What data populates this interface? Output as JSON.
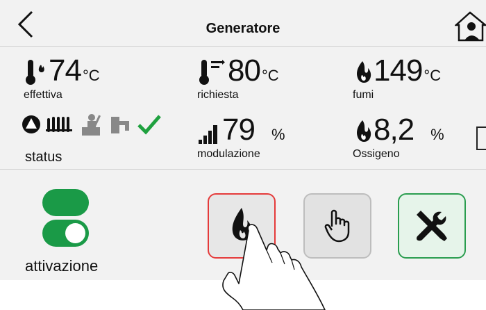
{
  "header": {
    "title": "Generatore",
    "back_icon": "chevron-left-icon",
    "home_icon": "home-icon"
  },
  "metrics": {
    "effettiva": {
      "value": "74",
      "unit": "°C",
      "label": "effettiva",
      "icon": "thermometer-flame-icon"
    },
    "richiesta": {
      "value": "80",
      "unit": "°C",
      "label": "richiesta",
      "icon": "thermometer-setpoint-icon"
    },
    "fumi": {
      "value": "149",
      "unit": "°C",
      "label": "fumi",
      "icon": "flame-icon"
    },
    "modulazione": {
      "value": "79",
      "unit": "%",
      "label": "modulazione",
      "icon": "signal-bars-icon"
    },
    "ossigeno": {
      "value": "8,2",
      "unit": "%",
      "label": "Ossigeno",
      "icon": "flame-icon"
    }
  },
  "status": {
    "label": "status",
    "icons": [
      "pump-icon",
      "radiator-icon",
      "chimney-sweep-icon",
      "tap-icon",
      "check-icon"
    ]
  },
  "activation": {
    "label": "attivazione",
    "icon": "toggle-on-icon",
    "state": "on"
  },
  "buttons": [
    {
      "name": "flame-button",
      "icon": "flame-icon",
      "state": "selected"
    },
    {
      "name": "manual-button",
      "icon": "hand-icon",
      "state": "normal"
    },
    {
      "name": "tools-button",
      "icon": "tools-icon",
      "state": "normal"
    }
  ],
  "colors": {
    "accent_green": "#1a9a47",
    "selected_red": "#e53a3a",
    "check_green": "#1fa13f"
  }
}
